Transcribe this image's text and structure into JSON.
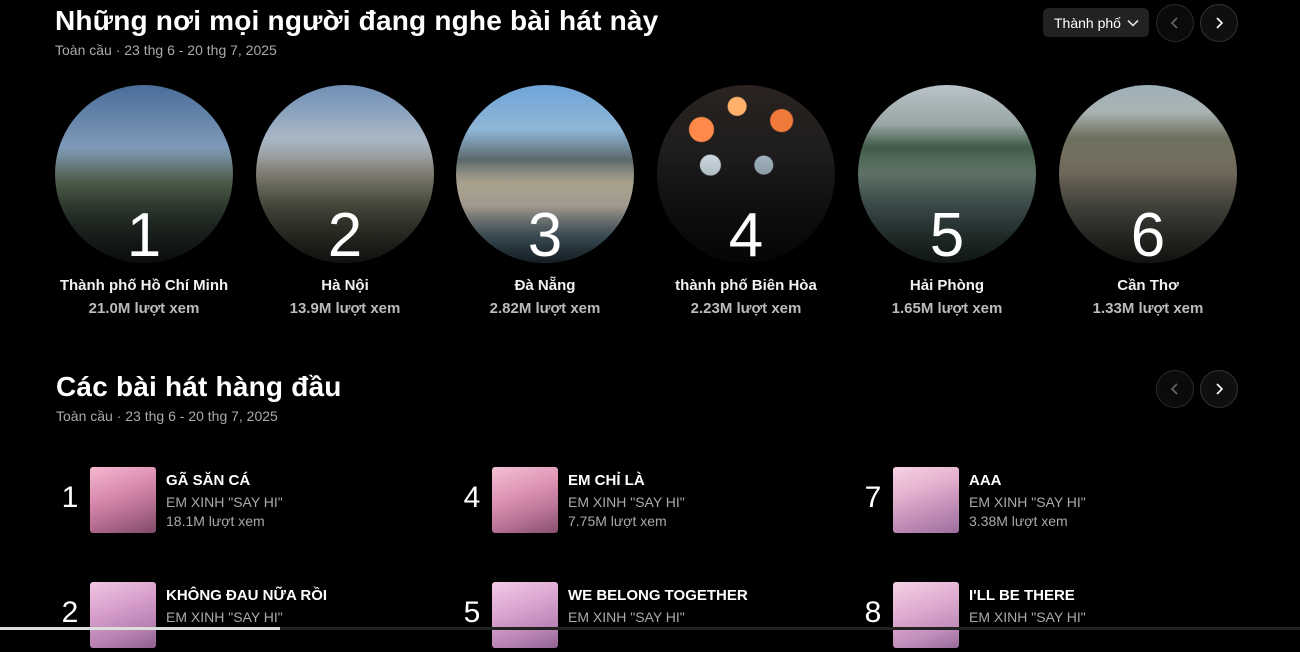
{
  "cities": {
    "title": "Những nơi mọi người đang nghe bài hát này",
    "subtitle": "Toàn cầu · 23 thg 6 - 20 thg 7, 2025",
    "filter": "Thành phố",
    "items": [
      {
        "rank": "1",
        "name": "Thành phố Hồ Chí Minh",
        "views": "21.0M lượt xem"
      },
      {
        "rank": "2",
        "name": "Hà Nội",
        "views": "13.9M lượt xem"
      },
      {
        "rank": "3",
        "name": "Đà Nẵng",
        "views": "2.82M lượt xem"
      },
      {
        "rank": "4",
        "name": "thành phố Biên Hòa",
        "views": "2.23M lượt xem"
      },
      {
        "rank": "5",
        "name": "Hải Phòng",
        "views": "1.65M lượt xem"
      },
      {
        "rank": "6",
        "name": "Cần Thơ",
        "views": "1.33M lượt xem"
      }
    ]
  },
  "songs": {
    "title": "Các bài hát hàng đầu",
    "subtitle": "Toàn cầu · 23 thg 6 - 20 thg 7, 2025",
    "items": [
      {
        "rank": "1",
        "title": "GÃ SĂN CÁ",
        "artist": "EM XINH \"SAY HI\"",
        "views": "18.1M lượt xem"
      },
      {
        "rank": "4",
        "title": "EM CHỈ LÀ",
        "artist": "EM XINH \"SAY HI\"",
        "views": "7.75M lượt xem"
      },
      {
        "rank": "7",
        "title": "AAA",
        "artist": "EM XINH \"SAY HI\"",
        "views": "3.38M lượt xem"
      },
      {
        "rank": "2",
        "title": "KHÔNG ĐAU NỮA RỒI",
        "artist": "EM XINH \"SAY HI\"",
        "views": ""
      },
      {
        "rank": "5",
        "title": "WE BELONG TOGETHER",
        "artist": "EM XINH \"SAY HI\"",
        "views": ""
      },
      {
        "rank": "8",
        "title": "I'LL BE THERE",
        "artist": "EM XINH \"SAY HI\"",
        "views": ""
      }
    ]
  },
  "icons": {
    "prev": "chevron-left-icon",
    "next": "chevron-right-icon",
    "dropdown": "chevron-down-icon"
  }
}
